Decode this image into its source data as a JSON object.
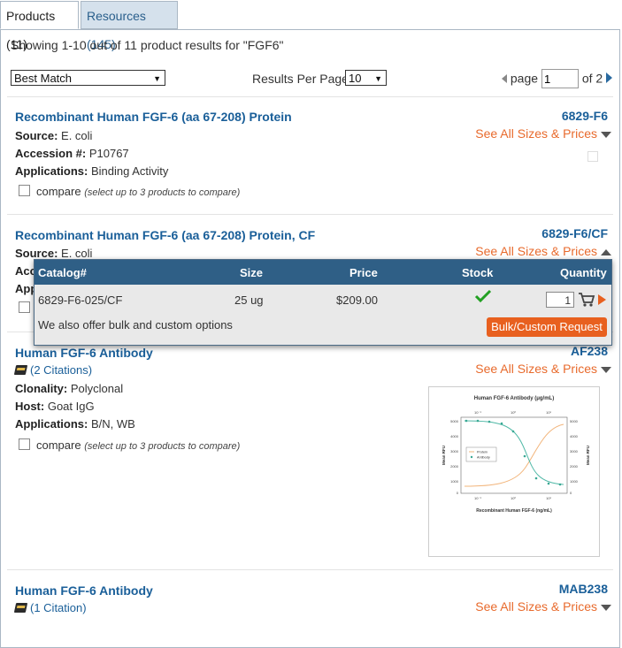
{
  "tabs": {
    "products": "Products (11)",
    "resources": "Resources (145)"
  },
  "showing": "Showing 1-10 out of 11 product results for \"FGF6\"",
  "sort": {
    "value": "Best Match"
  },
  "per_page": {
    "label": "Results Per Page",
    "value": "10"
  },
  "pager": {
    "label": "page",
    "current": "1",
    "of": "of 2"
  },
  "see_all": "See All Sizes & Prices",
  "compare_label": "compare",
  "compare_hint": "(select up to 3 products to compare)",
  "products": [
    {
      "title": "Recombinant Human FGF-6 (aa 67-208) Protein",
      "catalog": "6829-F6",
      "source_label": "Source:",
      "source": "E. coli",
      "accession_label": "Accession #:",
      "accession": "P10767",
      "applications_label": "Applications:",
      "applications": "Binding Activity"
    },
    {
      "title": "Recombinant Human FGF-6 (aa 67-208) Protein, CF",
      "catalog": "6829-F6/CF",
      "source_label": "Source:",
      "source": "E. coli",
      "line2_partial": "Acc",
      "line3_partial": "App"
    },
    {
      "title": "Human FGF-6 Antibody",
      "catalog": "AF238",
      "citations": "(2 Citations)",
      "clonality_label": "Clonality:",
      "clonality": "Polyclonal",
      "host_label": "Host:",
      "host": "Goat IgG",
      "applications_label": "Applications:",
      "applications": "B/N, WB"
    },
    {
      "title": "Human FGF-6 Antibody",
      "catalog": "MAB238",
      "citations": "(1 Citation)"
    }
  ],
  "popup": {
    "headers": {
      "catalog": "Catalog#",
      "size": "Size",
      "price": "Price",
      "stock": "Stock",
      "quantity": "Quantity"
    },
    "row": {
      "catalog": "6829-F6-025/CF",
      "size": "25 ug",
      "price": "$209.00",
      "qty": "1"
    },
    "bulk_note": "We also offer bulk and custom options",
    "bulk_button": "Bulk/Custom Request"
  },
  "chart_thumb": {
    "title": "Human FGF-6 Antibody (μg/mL)",
    "xlabel": "Recombinant Human FGF-6 (ng/mL)",
    "ylabel_left": "Mean RFU",
    "ylabel_right": "Mean RFU",
    "legend": [
      "Protein",
      "Antibody"
    ],
    "left_ticks": [
      "5000",
      "4000",
      "3000",
      "2000",
      "1000",
      "0"
    ],
    "right_ticks": [
      "5000",
      "4000",
      "3000",
      "2000",
      "1000",
      "0"
    ],
    "top_ticks": [
      "10⁻¹",
      "10⁰",
      "10¹"
    ],
    "bottom_ticks": [
      "10⁻¹",
      "10⁰",
      "10¹"
    ],
    "colors": {
      "protein": "#f2b47a",
      "antibody": "#4fb8a6"
    }
  }
}
